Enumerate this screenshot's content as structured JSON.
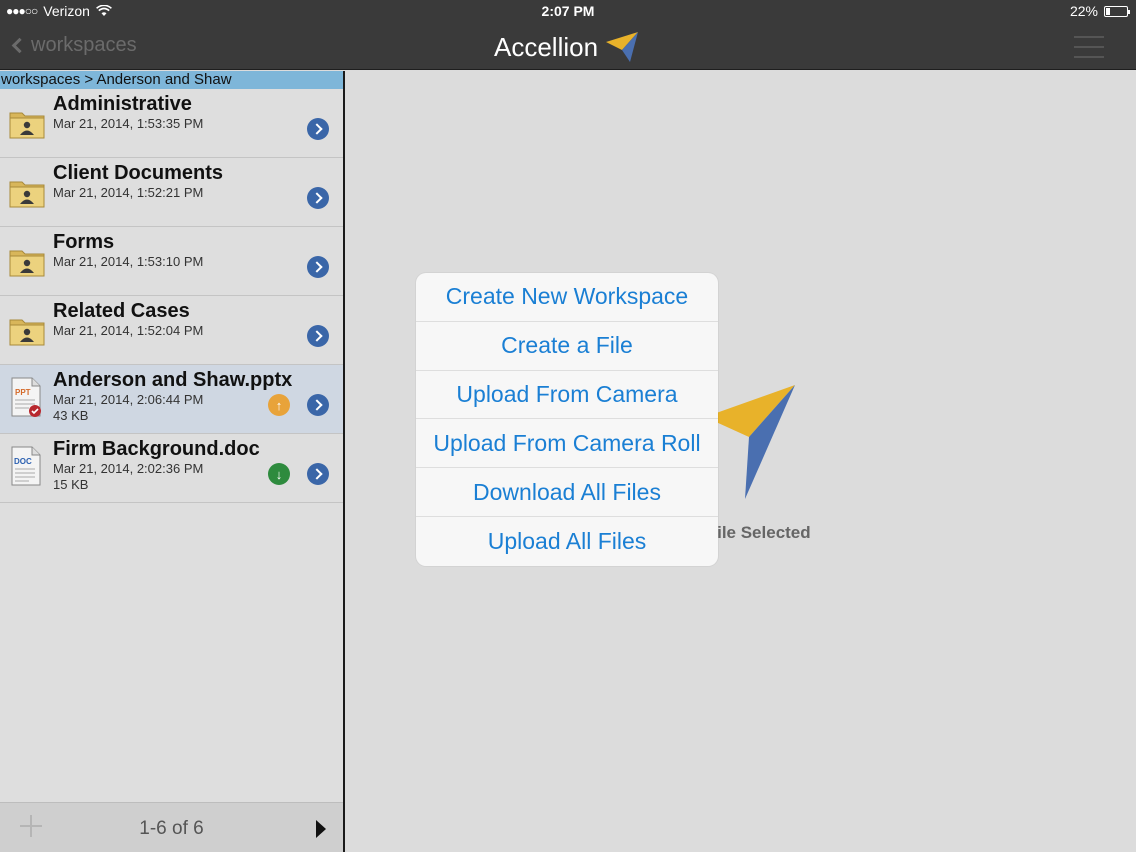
{
  "status_bar": {
    "signal": "●●●○○",
    "carrier": "Verizon",
    "time": "2:07 PM",
    "battery_text": "22%",
    "battery_level": 0.22
  },
  "nav": {
    "back_label": "workspaces",
    "brand_name": "Accellion"
  },
  "sidebar": {
    "breadcrumb": "workspaces > Anderson and Shaw",
    "items": [
      {
        "kind": "folder",
        "name": "Administrative",
        "date": "Mar 21, 2014, 1:53:35 PM"
      },
      {
        "kind": "folder",
        "name": "Client Documents",
        "date": "Mar 21, 2014, 1:52:21 PM"
      },
      {
        "kind": "folder",
        "name": "Forms",
        "date": "Mar 21, 2014, 1:53:10 PM"
      },
      {
        "kind": "folder",
        "name": "Related Cases",
        "date": "Mar 21, 2014, 1:52:04 PM"
      },
      {
        "kind": "file",
        "name": "Anderson and Shaw.pptx",
        "date": "Mar 21, 2014, 2:06:44 PM",
        "size": "43 KB",
        "file_type": "PPT",
        "sync": "upload"
      },
      {
        "kind": "file",
        "name": "Firm Background.doc",
        "date": "Mar 21, 2014, 2:02:36 PM",
        "size": "15 KB",
        "file_type": "DOC",
        "sync": "download"
      }
    ],
    "pager_text": "1-6 of 6"
  },
  "main": {
    "empty_text": "No File Selected"
  },
  "popover": {
    "items": [
      "Create New Workspace",
      "Create a File",
      "Upload From Camera",
      "Upload From Camera Roll",
      "Download All Files",
      "Upload All Files"
    ]
  },
  "colors": {
    "bar_bg": "#3a3a3a",
    "breadcrumb_bg": "#7eb6d9",
    "menu_text": "#1a7fd4",
    "chevron_button": "#3a66a8",
    "upload_badge": "#e8a33a",
    "download_badge": "#2e8b3e",
    "logo_yellow": "#e8b22a",
    "logo_blue": "#4a6fb0"
  }
}
